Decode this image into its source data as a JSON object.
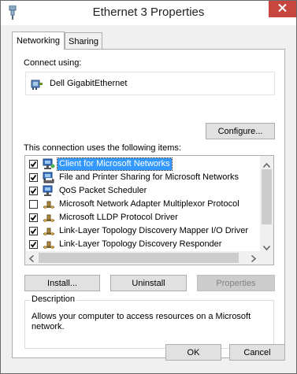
{
  "window": {
    "title": "Ethernet 3 Properties",
    "icon": "network-adapter-icon",
    "close_icon": "close-icon"
  },
  "tabs": [
    {
      "label": "Networking",
      "active": true
    },
    {
      "label": "Sharing",
      "active": false
    }
  ],
  "connect_using": {
    "label": "Connect using:",
    "adapter_name": "Dell GigabitEthernet",
    "adapter_icon": "network-card-icon",
    "configure_label": "Configure..."
  },
  "items_section": {
    "label": "This connection uses the following items:",
    "items": [
      {
        "label": "Client for Microsoft Networks",
        "checked": true,
        "selected": true,
        "icon": "client-network-icon"
      },
      {
        "label": "File and Printer Sharing for Microsoft Networks",
        "checked": true,
        "selected": false,
        "icon": "file-printer-sharing-icon"
      },
      {
        "label": "QoS Packet Scheduler",
        "checked": true,
        "selected": false,
        "icon": "qos-scheduler-icon"
      },
      {
        "label": "Microsoft Network Adapter Multiplexor Protocol",
        "checked": false,
        "selected": false,
        "icon": "protocol-icon"
      },
      {
        "label": "Microsoft LLDP Protocol Driver",
        "checked": true,
        "selected": false,
        "icon": "protocol-icon"
      },
      {
        "label": "Link-Layer Topology Discovery Mapper I/O Driver",
        "checked": true,
        "selected": false,
        "icon": "protocol-icon"
      },
      {
        "label": "Link-Layer Topology Discovery Responder",
        "checked": true,
        "selected": false,
        "icon": "protocol-icon"
      }
    ]
  },
  "buttons": {
    "install": "Install...",
    "uninstall": "Uninstall",
    "properties": "Properties",
    "ok": "OK",
    "cancel": "Cancel"
  },
  "description": {
    "legend": "Description",
    "text": "Allows your computer to access resources on a Microsoft network."
  },
  "colors": {
    "close_button": "#c7463d",
    "selection": "#3399ff",
    "focus_border": "#3c7fb1"
  }
}
